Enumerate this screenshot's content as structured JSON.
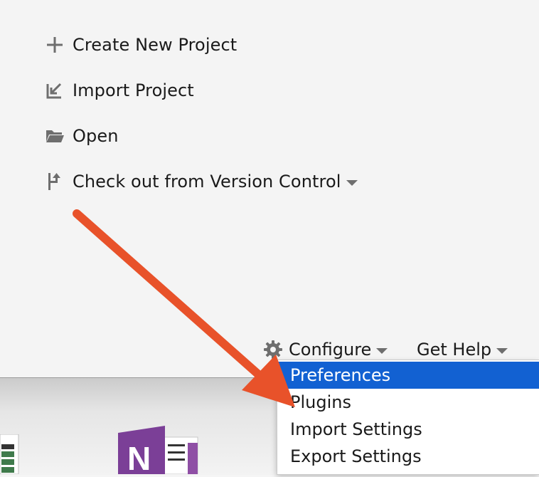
{
  "welcome": {
    "actions": [
      {
        "label": "Create New Project",
        "icon": "plus-icon"
      },
      {
        "label": "Import Project",
        "icon": "import-icon"
      },
      {
        "label": "Open",
        "icon": "folder-icon"
      },
      {
        "label": "Check out from Version Control",
        "icon": "checkout-icon",
        "has_dropdown": true
      }
    ],
    "footer": {
      "configure_label": "Configure",
      "help_label": "Get Help"
    }
  },
  "configure_menu": {
    "items": [
      {
        "label": "Preferences",
        "selected": true
      },
      {
        "label": "Plugins"
      },
      {
        "label": "Import Settings"
      },
      {
        "label": "Export Settings"
      }
    ]
  },
  "colors": {
    "selection": "#1261d2",
    "annotation_arrow": "#e8522a",
    "icon_gray": "#6e6e6e"
  }
}
